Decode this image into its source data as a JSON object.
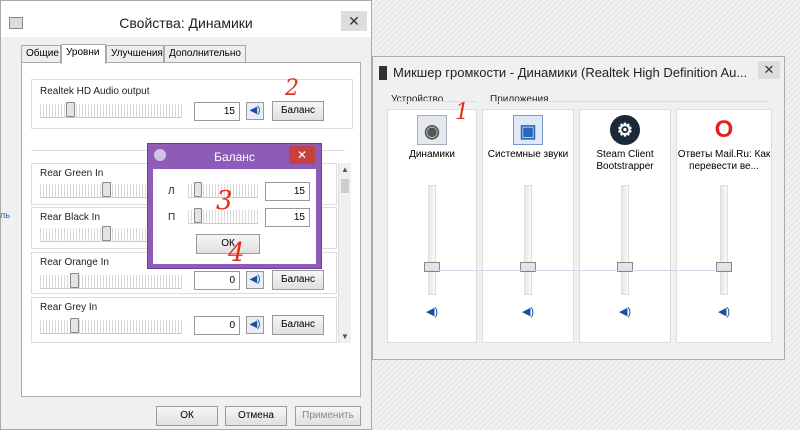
{
  "properties": {
    "title": "Свойства: Динамики",
    "close": "✕",
    "tabs": [
      "Общие",
      "Уровни",
      "Улучшения",
      "Дополнительно"
    ],
    "rows": [
      {
        "label": "Realtek HD Audio output",
        "value": "15",
        "button": "Баланс"
      },
      {
        "label": "Rear Green In",
        "value": "",
        "button": "Баланс"
      },
      {
        "label": "Rear Black In",
        "value": "",
        "button": "Баланс"
      },
      {
        "label": "Rear Orange In",
        "value": "0",
        "button": "Баланс"
      },
      {
        "label": "Rear Grey In",
        "value": "0",
        "button": "Баланс"
      }
    ],
    "ok": "ОК",
    "cancel": "Отмена",
    "apply": "Применить",
    "side_mark": "ль"
  },
  "balance": {
    "title": "Баланс",
    "close": "✕",
    "left_label": "Л",
    "right_label": "П",
    "left_value": "15",
    "right_value": "15",
    "ok": "ОК"
  },
  "mixer": {
    "title": "Микшер громкости - Динамики (Realtek High Definition Au...",
    "close": "✕",
    "device_header": "Устройство",
    "apps_header": "Приложения",
    "channels": [
      {
        "label": "Динамики",
        "icon": "speaker-icon"
      },
      {
        "label": "Системные звуки",
        "icon": "system-sounds-icon"
      },
      {
        "label": "Steam Client Bootstrapper",
        "icon": "steam-icon"
      },
      {
        "label": "Ответы Mail.Ru: Как перевести ве...",
        "icon": "opera-icon"
      }
    ]
  },
  "annotations": [
    "1",
    "2",
    "3",
    "4"
  ],
  "colors": {
    "balance_frame": "#8e5cb8",
    "close_red": "#c84141",
    "annotation_red": "#e0301e",
    "link_blue": "#1a4fa0"
  }
}
